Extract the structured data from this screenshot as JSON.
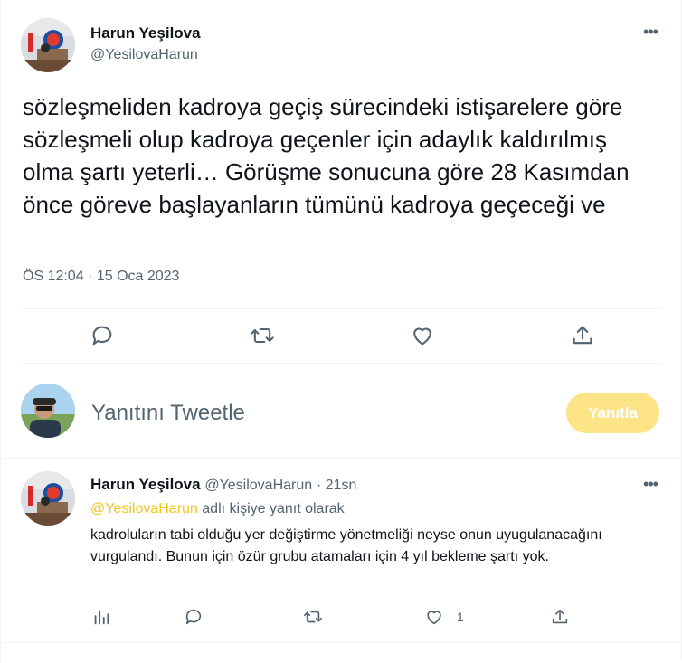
{
  "main_tweet": {
    "author_name": "Harun Yeşilova",
    "author_handle": "@YesilovaHarun",
    "text": "sözleşmeliden kadroya geçiş sürecindeki istişarelere göre sözleşmeli olup kadroya geçenler için adaylık kaldırılmış olma şartı yeterli… Görüşme sonucuna göre 28 Kasımdan önce göreve başlayanların tümünü kadroya geçeceği ve",
    "timestamp": "ÖS 12:04 · 15 Oca 2023",
    "more_icon": "more-icon"
  },
  "compose": {
    "placeholder": "Yanıtını Tweetle",
    "reply_button_label": "Yanıtla",
    "reply_button_color": "#fde486"
  },
  "reply_tweet": {
    "author_name": "Harun Yeşilova",
    "author_handle": "@YesilovaHarun",
    "time": "21sn",
    "replying_to_mention": "@YesilovaHarun",
    "replying_to_suffix": " adlı kişiye yanıt olarak",
    "text": "kadroluların tabi olduğu yer değiştirme yönetmeliği neyse onun uyugulanacağını vurgulandı. Bunun için özür grubu atamaları için 4 yıl bekleme şartı yok.",
    "like_count": "1"
  },
  "colors": {
    "accent": "#f5c518",
    "text_secondary": "#536471",
    "divider": "#eff3f4"
  }
}
